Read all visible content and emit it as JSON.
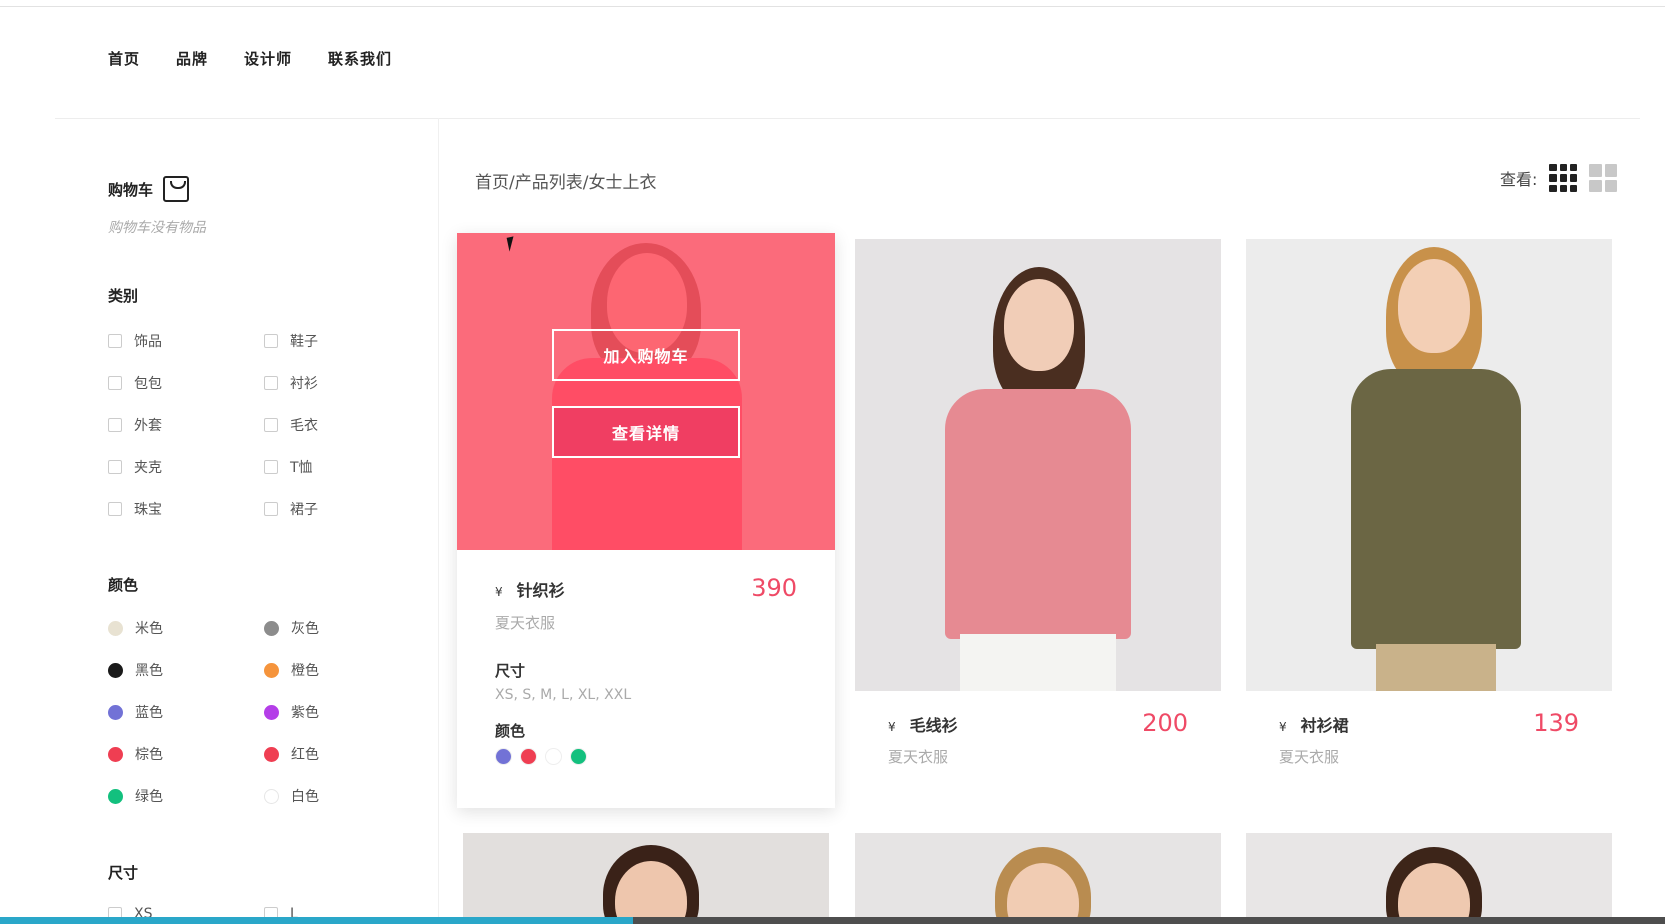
{
  "nav": {
    "items": [
      "首页",
      "品牌",
      "设计师",
      "联系我们"
    ]
  },
  "cart": {
    "title": "购物车",
    "empty_text": "购物车没有物品"
  },
  "categories": {
    "title": "类别",
    "items": [
      "饰品",
      "鞋子",
      "包包",
      "衬衫",
      "外套",
      "毛衣",
      "夹克",
      "T恤",
      "珠宝",
      "裙子"
    ]
  },
  "colors": {
    "title": "颜色",
    "items": [
      {
        "label": "米色",
        "hex": "#e8e2d2"
      },
      {
        "label": "灰色",
        "hex": "#8c8c8c"
      },
      {
        "label": "黑色",
        "hex": "#1a1a1a"
      },
      {
        "label": "橙色",
        "hex": "#f5943c"
      },
      {
        "label": "蓝色",
        "hex": "#7272d6"
      },
      {
        "label": "紫色",
        "hex": "#b43ee8"
      },
      {
        "label": "棕色",
        "hex": "#ef3e52"
      },
      {
        "label": "红色",
        "hex": "#ef3e52"
      },
      {
        "label": "绿色",
        "hex": "#13c07e"
      },
      {
        "label": "白色",
        "hex": "#ffffff"
      }
    ]
  },
  "sizes_filter": {
    "title": "尺寸",
    "items": [
      "XS",
      "L"
    ]
  },
  "breadcrumb": "首页/产品列表/女士上衣",
  "view": {
    "label": "查看:"
  },
  "overlay": {
    "add_to_cart": "加入购物车",
    "view_details": "查看详情"
  },
  "products": [
    {
      "currency": "¥",
      "name": "针织衫",
      "price": "390",
      "subtitle": "夏天衣服",
      "size_label": "尺寸",
      "sizes": "XS, S, M, L, XL, XXL",
      "color_label": "颜色",
      "swatches": [
        "#7272d6",
        "#ef3e52",
        "#ffffff",
        "#13c07e"
      ]
    },
    {
      "currency": "¥",
      "name": "毛线衫",
      "price": "200",
      "subtitle": "夏天衣服"
    },
    {
      "currency": "¥",
      "name": "衬衫裙",
      "price": "139",
      "subtitle": "夏天衣服"
    }
  ],
  "progress": {
    "fraction": 0.38
  },
  "colors_theme": {
    "accent": "#ef4a66",
    "overlay": "#ff5064"
  }
}
